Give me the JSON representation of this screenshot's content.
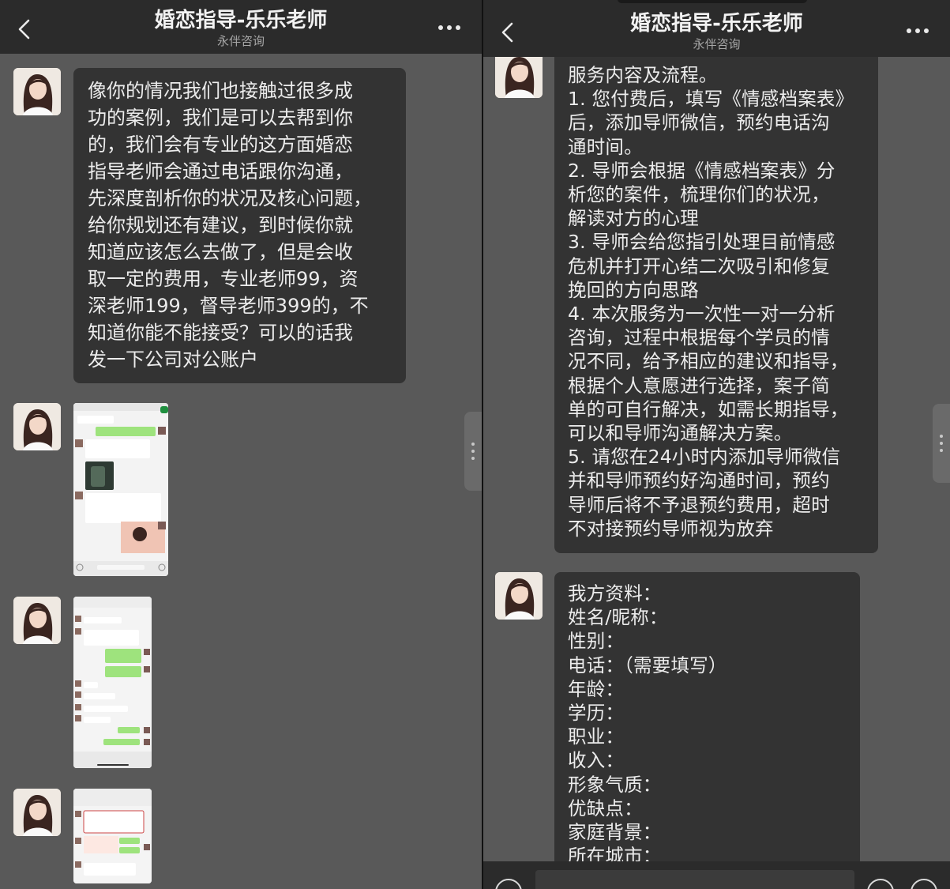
{
  "left": {
    "header": {
      "title": "婚恋指导-乐乐老师",
      "subtitle": "永伴咨询"
    },
    "message": "像你的情况我们也接触过很多成\n功的案例，我们是可以去帮到你\n的，我们会有专业的这方面婚恋\n指导老师会通过电话跟你沟通，\n先深度剖析你的状况及核心问题，\n给你规划还有建议，到时候你就\n知道应该怎么去做了，但是会收\n取一定的费用，专业老师99，资\n深老师199，督导老师399的，不\n知道你能不能接受？可以的话我\n发一下公司对公账户",
    "screenshots": [
      {
        "alt": "chat-screenshot-1"
      },
      {
        "alt": "chat-screenshot-2"
      },
      {
        "alt": "chat-screenshot-3"
      }
    ]
  },
  "right": {
    "header": {
      "title": "婚恋指导-乐乐老师",
      "subtitle": "永伴咨询"
    },
    "message1": "服务内容及流程。\n1. 您付费后，填写《情感档案表》\n后，添加导师微信，预约电话沟\n通时间。\n2. 导师会根据《情感档案表》分\n析您的案件，梳理你们的状况，\n解读对方的心理\n3. 导师会给您指引处理目前情感\n危机并打开心结二次吸引和修复\n挽回的方向思路\n4. 本次服务为一次性一对一分析\n咨询，过程中根据每个学员的情\n况不同，给予相应的建议和指导，\n根据个人意愿进行选择，案子简\n单的可自行解决，如需长期指导，\n可以和导师沟通解决方案。\n5. 请您在24小时内添加导师微信\n并和导师预约好沟通时间，预约\n导师后将不予退预约费用，超时\n不对接预约导师视为放弃",
    "message2": "我方资料：\n姓名/昵称：\n性别：\n电话：（需要填写）\n年龄：\n学历：\n职业：\n收入：\n形象气质：\n优缺点：\n家庭背景：\n所在城市："
  },
  "icons": {
    "back": "chevron-left-icon",
    "more": "more-dots-icon",
    "voice": "voice-icon",
    "emoji": "emoji-icon",
    "plus": "plus-icon"
  },
  "colors": {
    "background": "#595959",
    "bar": "#2b2b2b",
    "bubble": "#333333",
    "text": "#ececec"
  }
}
